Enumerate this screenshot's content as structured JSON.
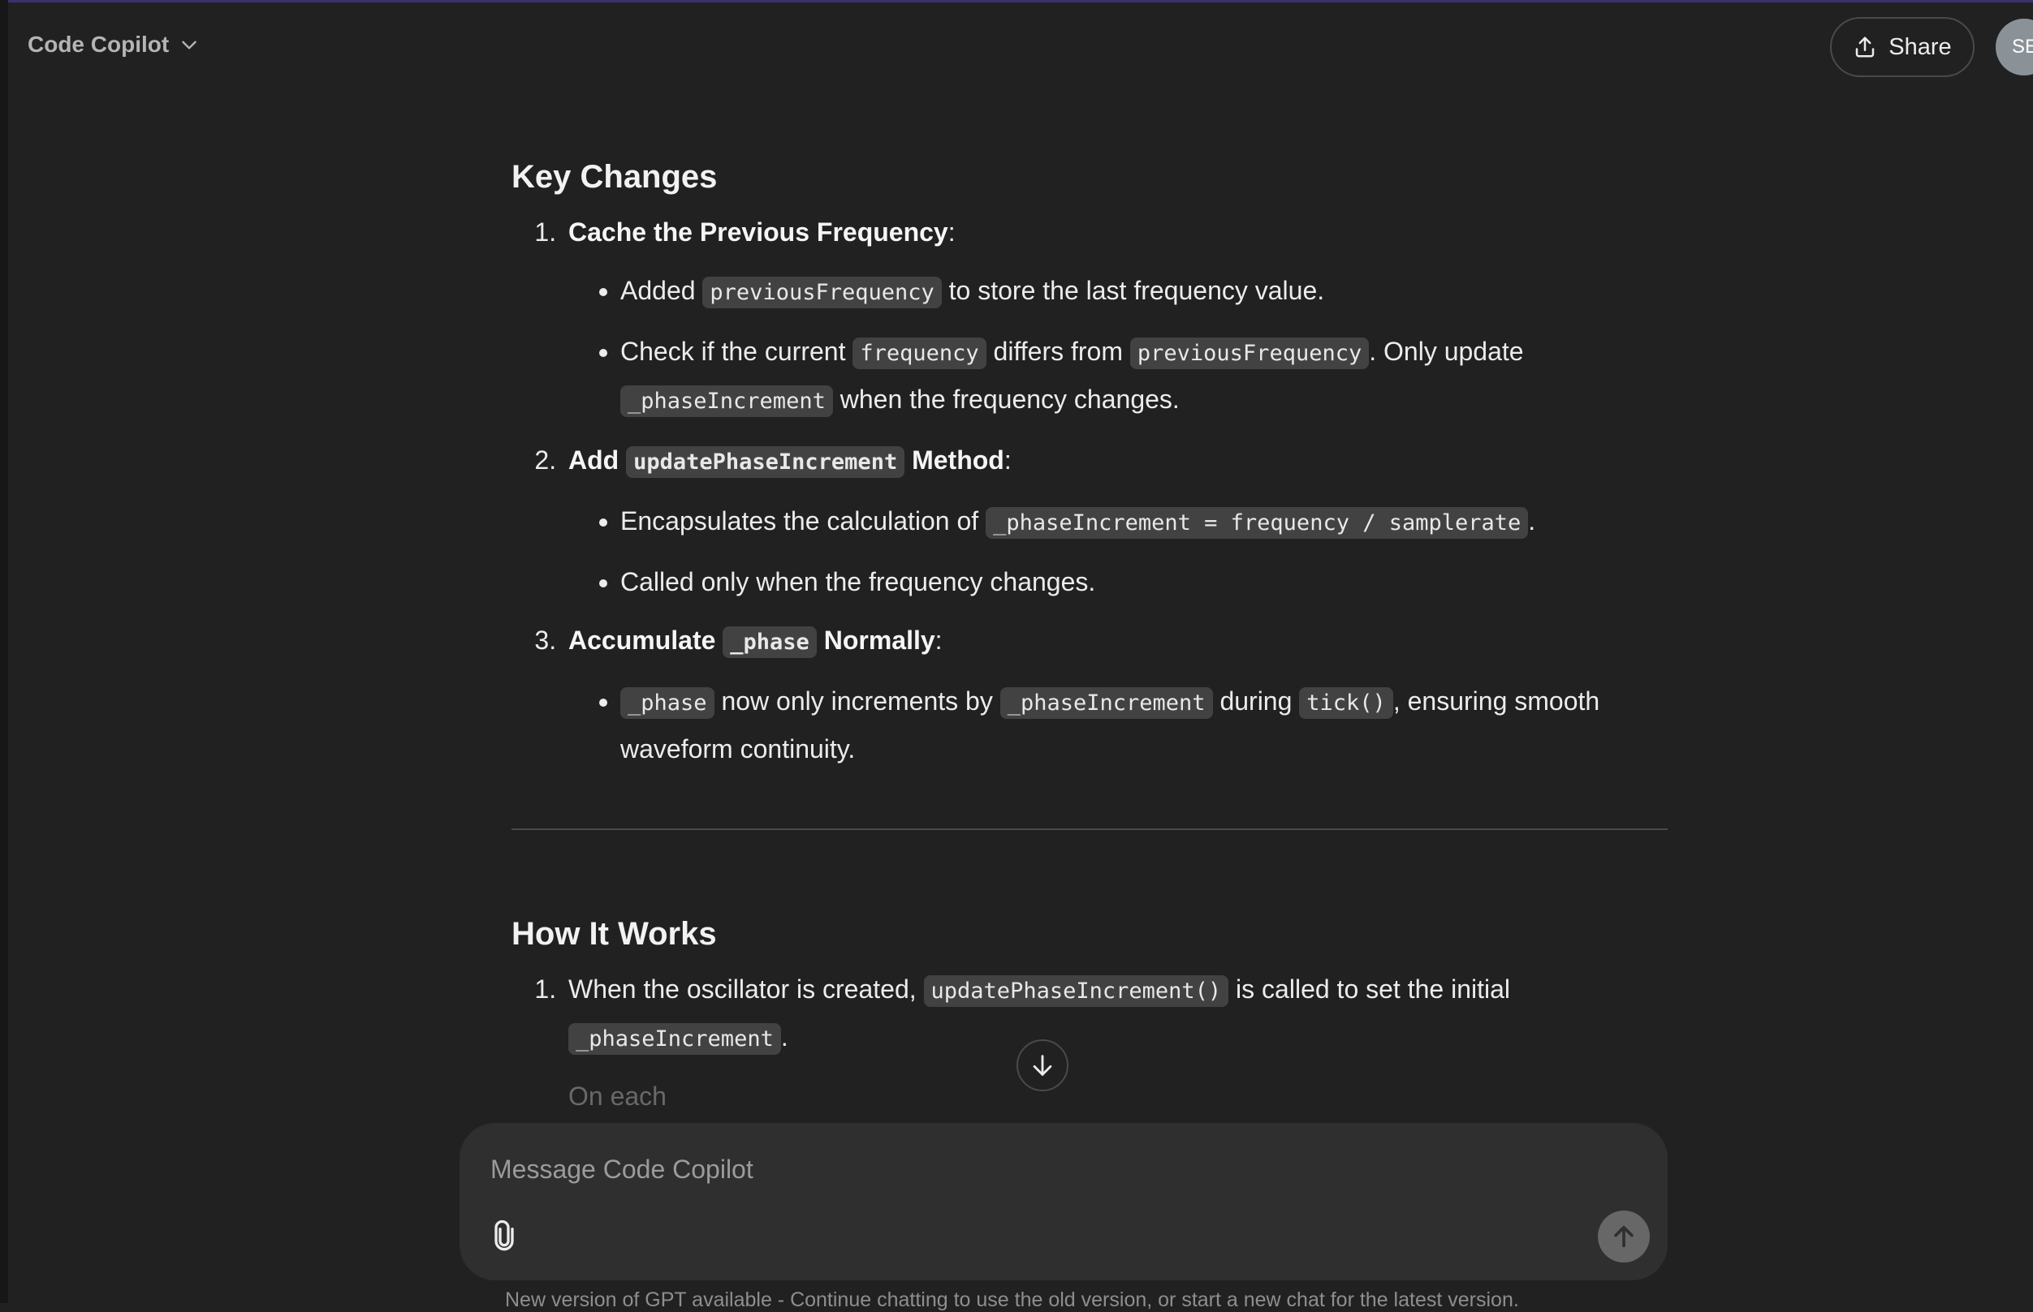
{
  "header": {
    "model_name": "Code Copilot",
    "share_label": "Share",
    "avatar_initials": "SE"
  },
  "sections": {
    "key_changes": {
      "title": "Key Changes",
      "item1": {
        "title": "Cache the Previous Frequency",
        "colon": ":",
        "b1_pre": "Added ",
        "b1_code": "previousFrequency",
        "b1_post": " to store the last frequency value.",
        "b2_pre": "Check if the current ",
        "b2_code1": "frequency",
        "b2_mid": " differs from ",
        "b2_code2": "previousFrequency",
        "b2_mid2": ". Only update ",
        "b2_code3": "_phaseIncrement",
        "b2_post": " when the frequency changes."
      },
      "item2": {
        "title_pre": "Add ",
        "title_code": "updatePhaseIncrement",
        "title_post": " Method",
        "colon": ":",
        "b1_pre": "Encapsulates the calculation of ",
        "b1_code": "_phaseIncrement = frequency / samplerate",
        "b1_post": ".",
        "b2": "Called only when the frequency changes."
      },
      "item3": {
        "title_pre": "Accumulate ",
        "title_code": "_phase",
        "title_post": " Normally",
        "colon": ":",
        "b1_code1": "_phase",
        "b1_mid": " now only increments by ",
        "b1_code2": "_phaseIncrement",
        "b1_mid2": " during ",
        "b1_code3": "tick()",
        "b1_post": ", ensuring smooth waveform continuity."
      }
    },
    "how_it_works": {
      "title": "How It Works",
      "item1": {
        "pre": "When the oscillator is created, ",
        "code1": "updatePhaseIncrement()",
        "mid": " is called to set the initial ",
        "code2": "_phaseIncrement",
        "post": "."
      },
      "item2_partial": "On each"
    }
  },
  "composer": {
    "placeholder": "Message Code Copilot"
  },
  "footer": {
    "note": "New version of GPT available - Continue chatting to use the old version, or start a new chat for the latest version."
  },
  "icons": {
    "model_chevron": "chevron-down-icon",
    "share": "share-upload-icon",
    "scroll_down": "arrow-down-icon",
    "attach": "paperclip-icon",
    "send": "arrow-up-icon"
  }
}
